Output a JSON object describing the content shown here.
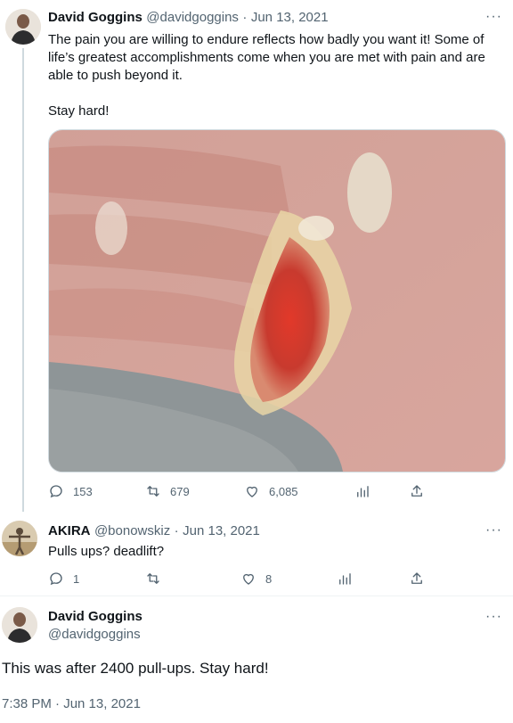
{
  "tweet1": {
    "name": "David Goggins",
    "handle": "@davidgoggins",
    "sep": "·",
    "date": "Jun 13, 2021",
    "text_line1": "The pain you are willing to endure reflects how badly you want it! Some of",
    "text_line2": "life’s greatest accomplishments come when you are met with pain and are",
    "text_line3": "able to push beyond it.",
    "text_line4": "Stay hard!",
    "replies": "153",
    "retweets": "679",
    "likes": "6,085",
    "more_icon": "more-dots-icon"
  },
  "tweet2": {
    "name": "AKIRA",
    "handle": "@bonowskiz",
    "sep": "·",
    "date": "Jun 13, 2021",
    "text": "Pulls ups? deadlift?",
    "replies": "1",
    "retweets": "",
    "likes": "8"
  },
  "tweet3": {
    "name": "David Goggins",
    "handle": "@davidgoggins",
    "text": "This was after 2400 pull-ups. Stay hard!",
    "timestamp": "7:38 PM · Jun 13, 2021"
  },
  "colors": {
    "text": "#0f1419",
    "secondary": "#536471",
    "divider": "#eff3f4",
    "thread_line": "#cfd9de"
  }
}
